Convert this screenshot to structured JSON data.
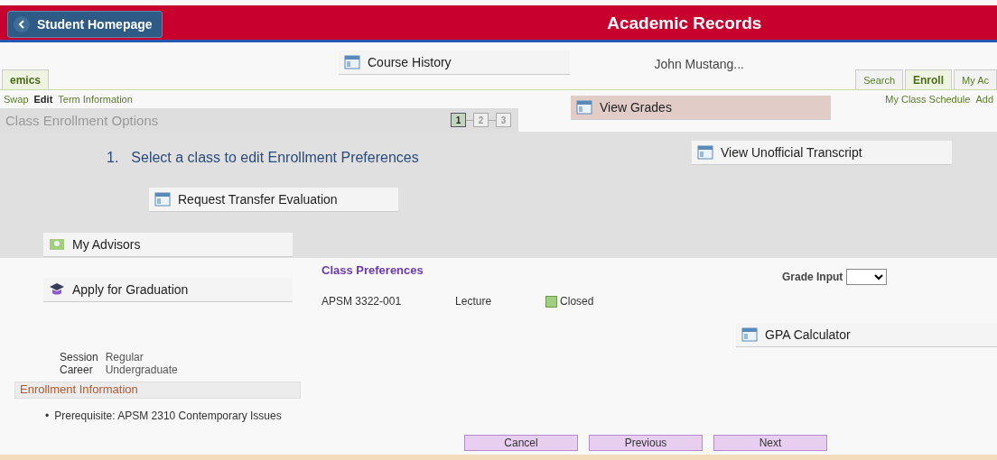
{
  "header": {
    "back_button": "Student Homepage",
    "title": "Academic Records"
  },
  "user_name": "John Mustang...",
  "page_tabs": [
    {
      "label": "emics",
      "selected": true
    }
  ],
  "nav_tabs": [
    {
      "label": "Search",
      "selected": false
    },
    {
      "label": "Enroll",
      "selected": true
    },
    {
      "label": "My Ac",
      "selected": false
    }
  ],
  "links_left": [
    {
      "label": "Swap",
      "selected": false
    },
    {
      "label": "Edit",
      "selected": true
    },
    {
      "label": "Term Information",
      "selected": false
    }
  ],
  "links_right": [
    "My Class Schedule",
    "Add"
  ],
  "section_title": "Class Enrollment Options",
  "steps": [
    {
      "label": "1",
      "selected": true
    },
    {
      "label": "2",
      "selected": false
    },
    {
      "label": "3",
      "selected": false
    }
  ],
  "step_heading": {
    "number": "1.",
    "text": "Select a class to edit  Enrollment Preferences"
  },
  "class_preferences": {
    "title": "Class Preferences",
    "class": "APSM 3322-001",
    "component": "Lecture",
    "status": "Closed",
    "grade_input_label": "Grade Input"
  },
  "details": [
    {
      "label": "Session",
      "value": "Regular"
    },
    {
      "label": "Career",
      "value": "Undergraduate"
    }
  ],
  "enrollment_information": {
    "title": "Enrollment Information",
    "items": [
      {
        "bullet": "•",
        "text": "Prerequisite: APSM 2310 Contemporary Issues"
      }
    ]
  },
  "buttons": [
    "Cancel",
    "Previous",
    "Next"
  ],
  "menu": [
    {
      "label": "Course History",
      "kind": "history",
      "selected": false
    },
    {
      "label": "View Grades",
      "kind": "grades",
      "selected": true
    },
    {
      "label": "View Unofficial Transcript",
      "kind": "transcript",
      "selected": false
    },
    {
      "label": "Request Transfer Evaluation",
      "kind": "transfer",
      "selected": false
    },
    {
      "label": "My Advisors",
      "kind": "advisors",
      "selected": false
    },
    {
      "label": "Apply for Graduation",
      "kind": "graduation",
      "selected": false
    },
    {
      "label": "GPA Calculator",
      "kind": "calculator",
      "selected": false
    }
  ]
}
